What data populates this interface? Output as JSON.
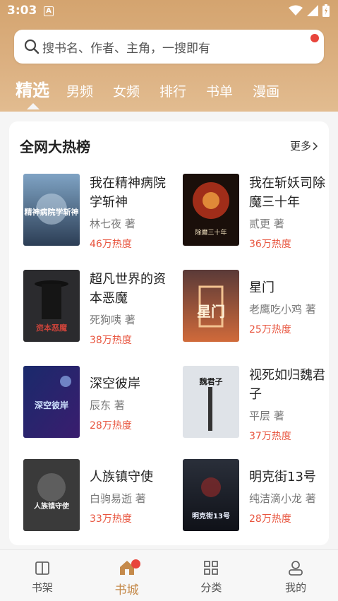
{
  "status": {
    "time": "3:03",
    "a_icon": "A"
  },
  "search": {
    "placeholder": "搜书名、作者、主角，一搜即有"
  },
  "tabs": [
    {
      "label": "精选",
      "active": true
    },
    {
      "label": "男频"
    },
    {
      "label": "女频"
    },
    {
      "label": "排行"
    },
    {
      "label": "书单"
    },
    {
      "label": "漫画"
    }
  ],
  "ranking": {
    "title": "全网大热榜",
    "more": "更多",
    "books": [
      {
        "title": "我在精神病院学斩神",
        "author": "林七夜 著",
        "heat": "46万热度",
        "cover_text": "精神病院学斩神"
      },
      {
        "title": "我在斩妖司除魔三十年",
        "author": "贰更 著",
        "heat": "36万热度",
        "cover_text": "除魔三十年"
      },
      {
        "title": "超凡世界的资本恶魔",
        "author": "死狗咦 著",
        "heat": "38万热度",
        "cover_text": "资本恶魔"
      },
      {
        "title": "星门",
        "author": "老鹰吃小鸡 著",
        "heat": "25万热度",
        "cover_text": "星门"
      },
      {
        "title": "深空彼岸",
        "author": "辰东 著",
        "heat": "28万热度",
        "cover_text": "深空彼岸"
      },
      {
        "title": "视死如归魏君子",
        "author": "平层 著",
        "heat": "37万热度",
        "cover_text": "魏君子"
      },
      {
        "title": "人族镇守使",
        "author": "白驹易逝 著",
        "heat": "33万热度",
        "cover_text": "人族镇守使"
      },
      {
        "title": "明克街13号",
        "author": "纯洁滴小龙 著",
        "heat": "28万热度",
        "cover_text": "明克街13号"
      }
    ]
  },
  "nav": [
    {
      "label": "书架"
    },
    {
      "label": "书城",
      "active": true
    },
    {
      "label": "分类"
    },
    {
      "label": "我的"
    }
  ],
  "colors": {
    "accent": "#c58a4b",
    "heat": "#e8553f",
    "header": "#d4a46f",
    "badge": "#e8453c"
  }
}
